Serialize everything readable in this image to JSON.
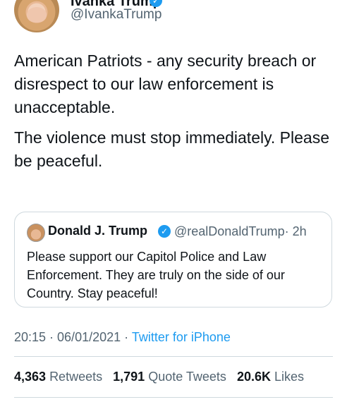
{
  "author": {
    "display_name": "Ivanka Trump",
    "handle": "@IvankaTrump"
  },
  "tweet": {
    "paragraphs": [
      "American Patriots - any security breach or disrespect to our law enforcement is unacceptable.",
      "The violence must stop immediately. Please be peaceful."
    ]
  },
  "quoted_tweet": {
    "display_name": "Donald J. Trump",
    "handle": "@realDonaldTrump",
    "age": "· 2h",
    "text": "Please support our Capitol Police and Law Enforcement. They are truly on the side of our Country. Stay peaceful!"
  },
  "meta": {
    "time": "20:15 · 06/01/2021 ·",
    "source": "Twitter for iPhone"
  },
  "stats": {
    "retweets_count": "4,363",
    "retweets_label": "Retweets",
    "quotes_count": "1,791",
    "quotes_label": "Quote Tweets",
    "likes_count": "20.6K",
    "likes_label": "Likes"
  },
  "colors": {
    "text": "#0f1419",
    "secondary": "#536471",
    "accent": "#1d9bf0",
    "border": "#cfd9de"
  },
  "icons": {
    "verified": "verified-badge-icon"
  }
}
